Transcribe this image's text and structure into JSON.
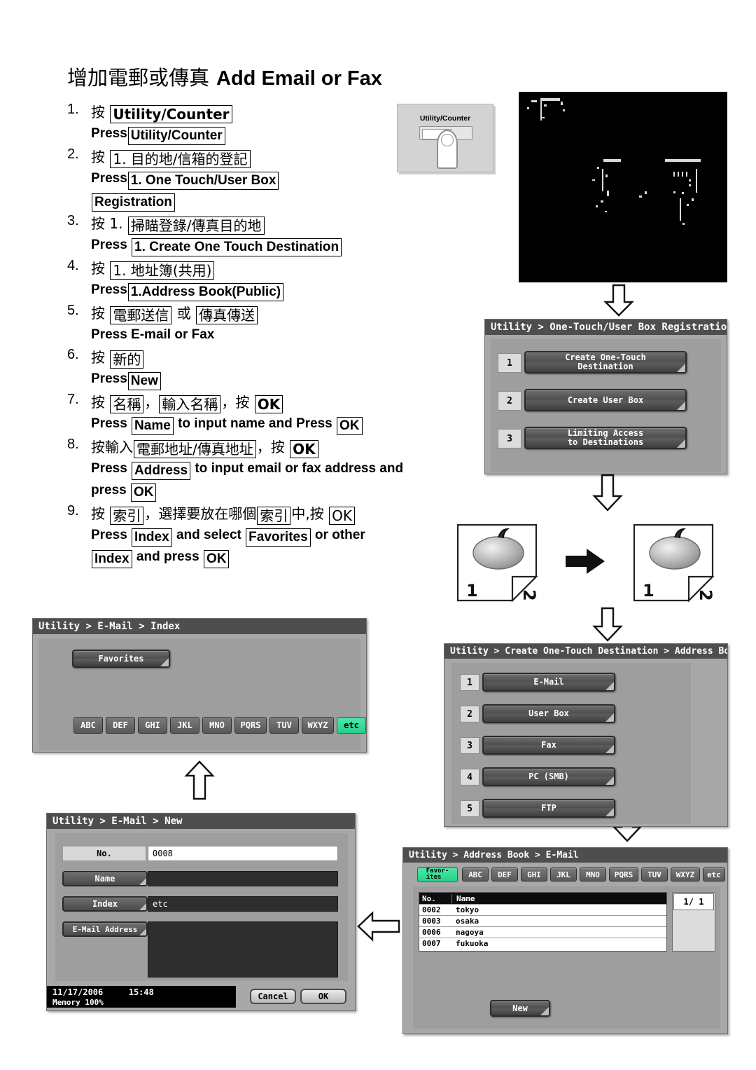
{
  "title": {
    "zh": "增加電郵或傳真",
    "en": "Add Email or Fax"
  },
  "steps": [
    {
      "num": "1.",
      "lines": [
        {
          "lang": "zh",
          "parts": [
            {
              "t": "按 ",
              "box": false
            },
            {
              "t": "Utility/Counter",
              "box": true,
              "bold": true
            }
          ]
        },
        {
          "lang": "en",
          "parts": [
            {
              "t": "Press",
              "box": false
            },
            {
              "t": "Utility/Counter",
              "box": true
            }
          ]
        }
      ]
    },
    {
      "num": "2.",
      "lines": [
        {
          "lang": "zh",
          "parts": [
            {
              "t": "按 ",
              "box": false
            },
            {
              "t": "1. 目的地/信箱的登記",
              "box": true
            }
          ]
        },
        {
          "lang": "en",
          "parts": [
            {
              "t": "Press",
              "box": false
            },
            {
              "t": "1. One Touch/User Box",
              "box": true
            }
          ]
        },
        {
          "lang": "en",
          "parts": [
            {
              "t": "Registration",
              "box": true
            }
          ]
        }
      ]
    },
    {
      "num": "3.",
      "lines": [
        {
          "lang": "zh",
          "parts": [
            {
              "t": "按 1. ",
              "box": false
            },
            {
              "t": "掃瞄登錄/傳真目的地",
              "box": true
            }
          ]
        },
        {
          "lang": "en",
          "parts": [
            {
              "t": "Press ",
              "box": false
            },
            {
              "t": "1. Create One Touch Destination",
              "box": true
            }
          ]
        }
      ]
    },
    {
      "num": "4.",
      "lines": [
        {
          "lang": "zh",
          "parts": [
            {
              "t": "按 ",
              "box": false
            },
            {
              "t": "1. 地址簿(共用)",
              "box": true
            }
          ]
        },
        {
          "lang": "en",
          "parts": [
            {
              "t": "Press",
              "box": false
            },
            {
              "t": "1.Address Book(Public)",
              "box": true
            }
          ]
        }
      ]
    },
    {
      "num": "5.",
      "lines": [
        {
          "lang": "zh",
          "parts": [
            {
              "t": "按 ",
              "box": false
            },
            {
              "t": "電郵送信",
              "box": true
            },
            {
              "t": " 或 ",
              "box": false
            },
            {
              "t": "傳真傳送",
              "box": true
            }
          ]
        },
        {
          "lang": "en",
          "parts": [
            {
              "t": "Press E-mail or Fax",
              "box": false
            }
          ]
        }
      ]
    },
    {
      "num": "6.",
      "lines": [
        {
          "lang": "zh",
          "parts": [
            {
              "t": "按 ",
              "box": false
            },
            {
              "t": "新的",
              "box": true
            }
          ]
        },
        {
          "lang": "en",
          "parts": [
            {
              "t": "Press",
              "box": false
            },
            {
              "t": "New",
              "box": true
            }
          ]
        }
      ]
    },
    {
      "num": "7.",
      "lines": [
        {
          "lang": "zh",
          "parts": [
            {
              "t": "按 ",
              "box": false
            },
            {
              "t": "名稱",
              "box": true
            },
            {
              "t": "，",
              "box": false
            },
            {
              "t": "輸入名稱",
              "box": true
            },
            {
              "t": "，按 ",
              "box": false
            },
            {
              "t": "OK",
              "box": true,
              "bold": true
            }
          ]
        },
        {
          "lang": "en",
          "parts": [
            {
              "t": "Press ",
              "box": false
            },
            {
              "t": "Name",
              "box": true
            },
            {
              "t": " to input name and Press ",
              "box": false
            },
            {
              "t": "OK",
              "box": true
            }
          ]
        }
      ]
    },
    {
      "num": "8.",
      "lines": [
        {
          "lang": "zh",
          "parts": [
            {
              "t": "按輸入",
              "box": false
            },
            {
              "t": "電郵地址/傳真地址",
              "box": true
            },
            {
              "t": "，按 ",
              "box": false
            },
            {
              "t": "OK",
              "box": true,
              "bold": true
            }
          ]
        },
        {
          "lang": "en",
          "parts": [
            {
              "t": "Press ",
              "box": false
            },
            {
              "t": "Address",
              "box": true
            },
            {
              "t": " to input email or fax address and",
              "box": false
            }
          ]
        },
        {
          "lang": "en",
          "parts": [
            {
              "t": "press ",
              "box": false
            },
            {
              "t": "OK",
              "box": true
            }
          ]
        }
      ]
    },
    {
      "num": "9.",
      "lines": [
        {
          "lang": "zh",
          "parts": [
            {
              "t": "按 ",
              "box": false
            },
            {
              "t": "索引",
              "box": true
            },
            {
              "t": "，選擇要放在哪個",
              "box": false
            },
            {
              "t": "索引",
              "box": true
            },
            {
              "t": "中,按 ",
              "box": false
            },
            {
              "t": "OK",
              "box": true
            }
          ]
        },
        {
          "lang": "en",
          "parts": [
            {
              "t": "Press ",
              "box": false
            },
            {
              "t": "Index",
              "box": true
            },
            {
              "t": " and select ",
              "box": false
            },
            {
              "t": "Favorites",
              "box": true
            },
            {
              "t": " or other",
              "box": false
            }
          ]
        },
        {
          "lang": "en",
          "parts": [
            {
              "t": "Index",
              "box": true
            },
            {
              "t": " and press ",
              "box": false
            },
            {
              "t": "OK",
              "box": true
            }
          ]
        }
      ]
    }
  ],
  "key_illustration": {
    "label": "Utility/Counter"
  },
  "screen_registration": {
    "breadcrumb": "Utility > One-Touch/User Box Registration",
    "items": [
      {
        "num": "1",
        "label": "Create One-Touch\nDestination"
      },
      {
        "num": "2",
        "label": "Create User Box"
      },
      {
        "num": "3",
        "label": "Limiting Access\nto Destinations"
      }
    ]
  },
  "screen_address_book": {
    "breadcrumb": "Utility > Create One-Touch Destination > Address Book",
    "items": [
      {
        "num": "1",
        "label": "E-Mail"
      },
      {
        "num": "2",
        "label": "User Box"
      },
      {
        "num": "3",
        "label": "Fax"
      },
      {
        "num": "4",
        "label": "PC (SMB)"
      },
      {
        "num": "5",
        "label": "FTP"
      }
    ]
  },
  "screen_email_list": {
    "breadcrumb": "Utility > Address Book > E-Mail",
    "tabs": [
      "Favor-\nites",
      "ABC",
      "DEF",
      "GHI",
      "JKL",
      "MNO",
      "PQRS",
      "TUV",
      "WXYZ",
      "etc"
    ],
    "selected_tab": "Favor-\nites",
    "columns": [
      "No.",
      "Name"
    ],
    "rows": [
      {
        "no": "0002",
        "name": "tokyo"
      },
      {
        "no": "0003",
        "name": "osaka"
      },
      {
        "no": "0006",
        "name": "nagoya"
      },
      {
        "no": "0007",
        "name": "fukuoka"
      }
    ],
    "page": "1/  1",
    "new_button": "New"
  },
  "screen_index": {
    "breadcrumb": "Utility > E-Mail > Index",
    "favorites_button": "Favorites",
    "tabs": [
      "ABC",
      "DEF",
      "GHI",
      "JKL",
      "MNO",
      "PQRS",
      "TUV",
      "WXYZ",
      "etc"
    ],
    "selected_tab": "etc",
    "selected_color": "#2bdd96"
  },
  "screen_new": {
    "breadcrumb": "Utility > E-Mail > New",
    "fields": [
      {
        "label": "No.",
        "value": "0008",
        "style": "static"
      },
      {
        "label": "Name",
        "value": "",
        "style": "button"
      },
      {
        "label": "Index",
        "value": "etc",
        "style": "button"
      },
      {
        "label": "E-Mail Address",
        "value": "",
        "style": "button"
      }
    ],
    "status_date": "11/17/2006",
    "status_time": "15:48",
    "status_memory": "Memory         100%",
    "cancel_button": "Cancel",
    "ok_button": "OK"
  }
}
